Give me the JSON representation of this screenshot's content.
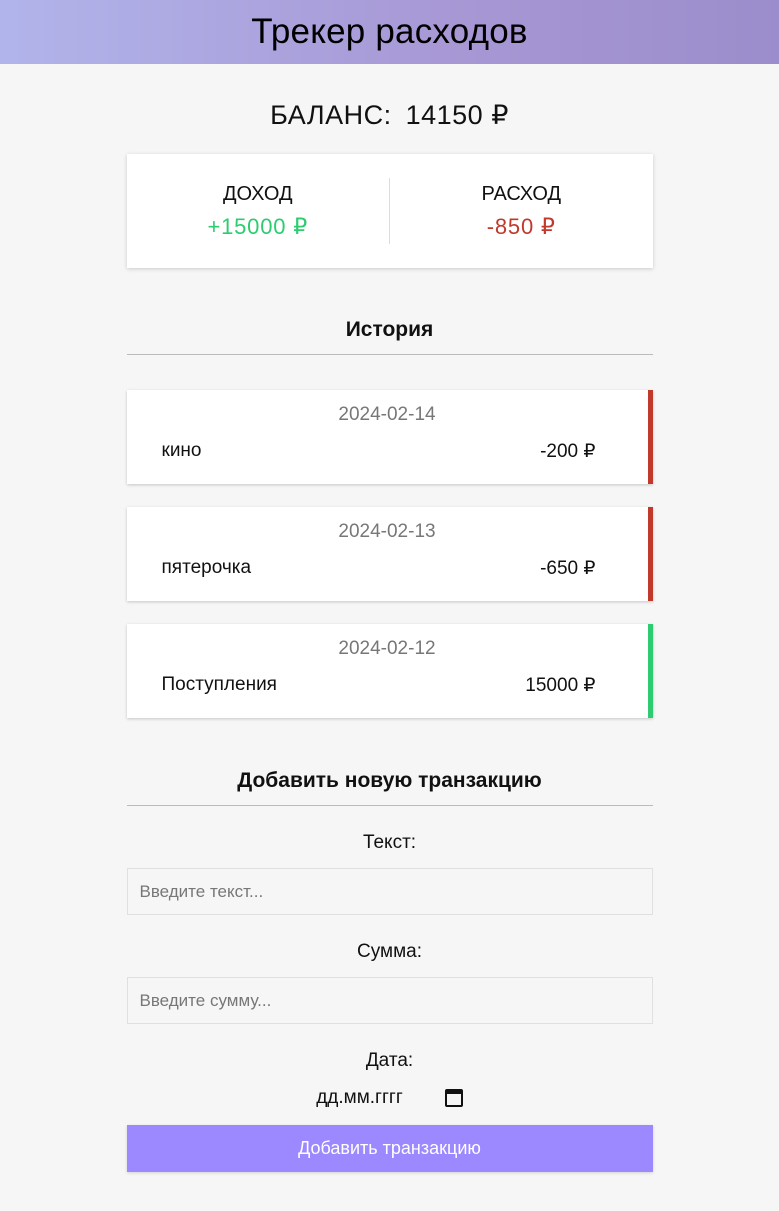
{
  "header": {
    "title": "Трекер расходов"
  },
  "balance": {
    "label": "БАЛАНС:",
    "value": "14150 ₽"
  },
  "summary": {
    "income_label": "ДОХОД",
    "income_value": "+15000 ₽",
    "expense_label": "РАСХОД",
    "expense_value": "-850 ₽"
  },
  "history": {
    "title": "История",
    "items": [
      {
        "date": "2024-02-14",
        "text": "кино",
        "amount": "-200 ₽",
        "type": "expense"
      },
      {
        "date": "2024-02-13",
        "text": "пятерочка",
        "amount": "-650 ₽",
        "type": "expense"
      },
      {
        "date": "2024-02-12",
        "text": "Поступления",
        "amount": "15000 ₽",
        "type": "income"
      }
    ]
  },
  "form": {
    "title": "Добавить новую транзакцию",
    "text_label": "Текст:",
    "text_placeholder": "Введите текст...",
    "amount_label": "Сумма:",
    "amount_placeholder": "Введите сумму...",
    "date_label": "Дата:",
    "date_placeholder": "дд.мм.гггг",
    "submit_label": "Добавить транзакцию"
  },
  "colors": {
    "income": "#2ecc71",
    "expense": "#c0392b",
    "button": "#9c88ff"
  },
  "icons": {
    "date_picker": "calendar-icon"
  }
}
